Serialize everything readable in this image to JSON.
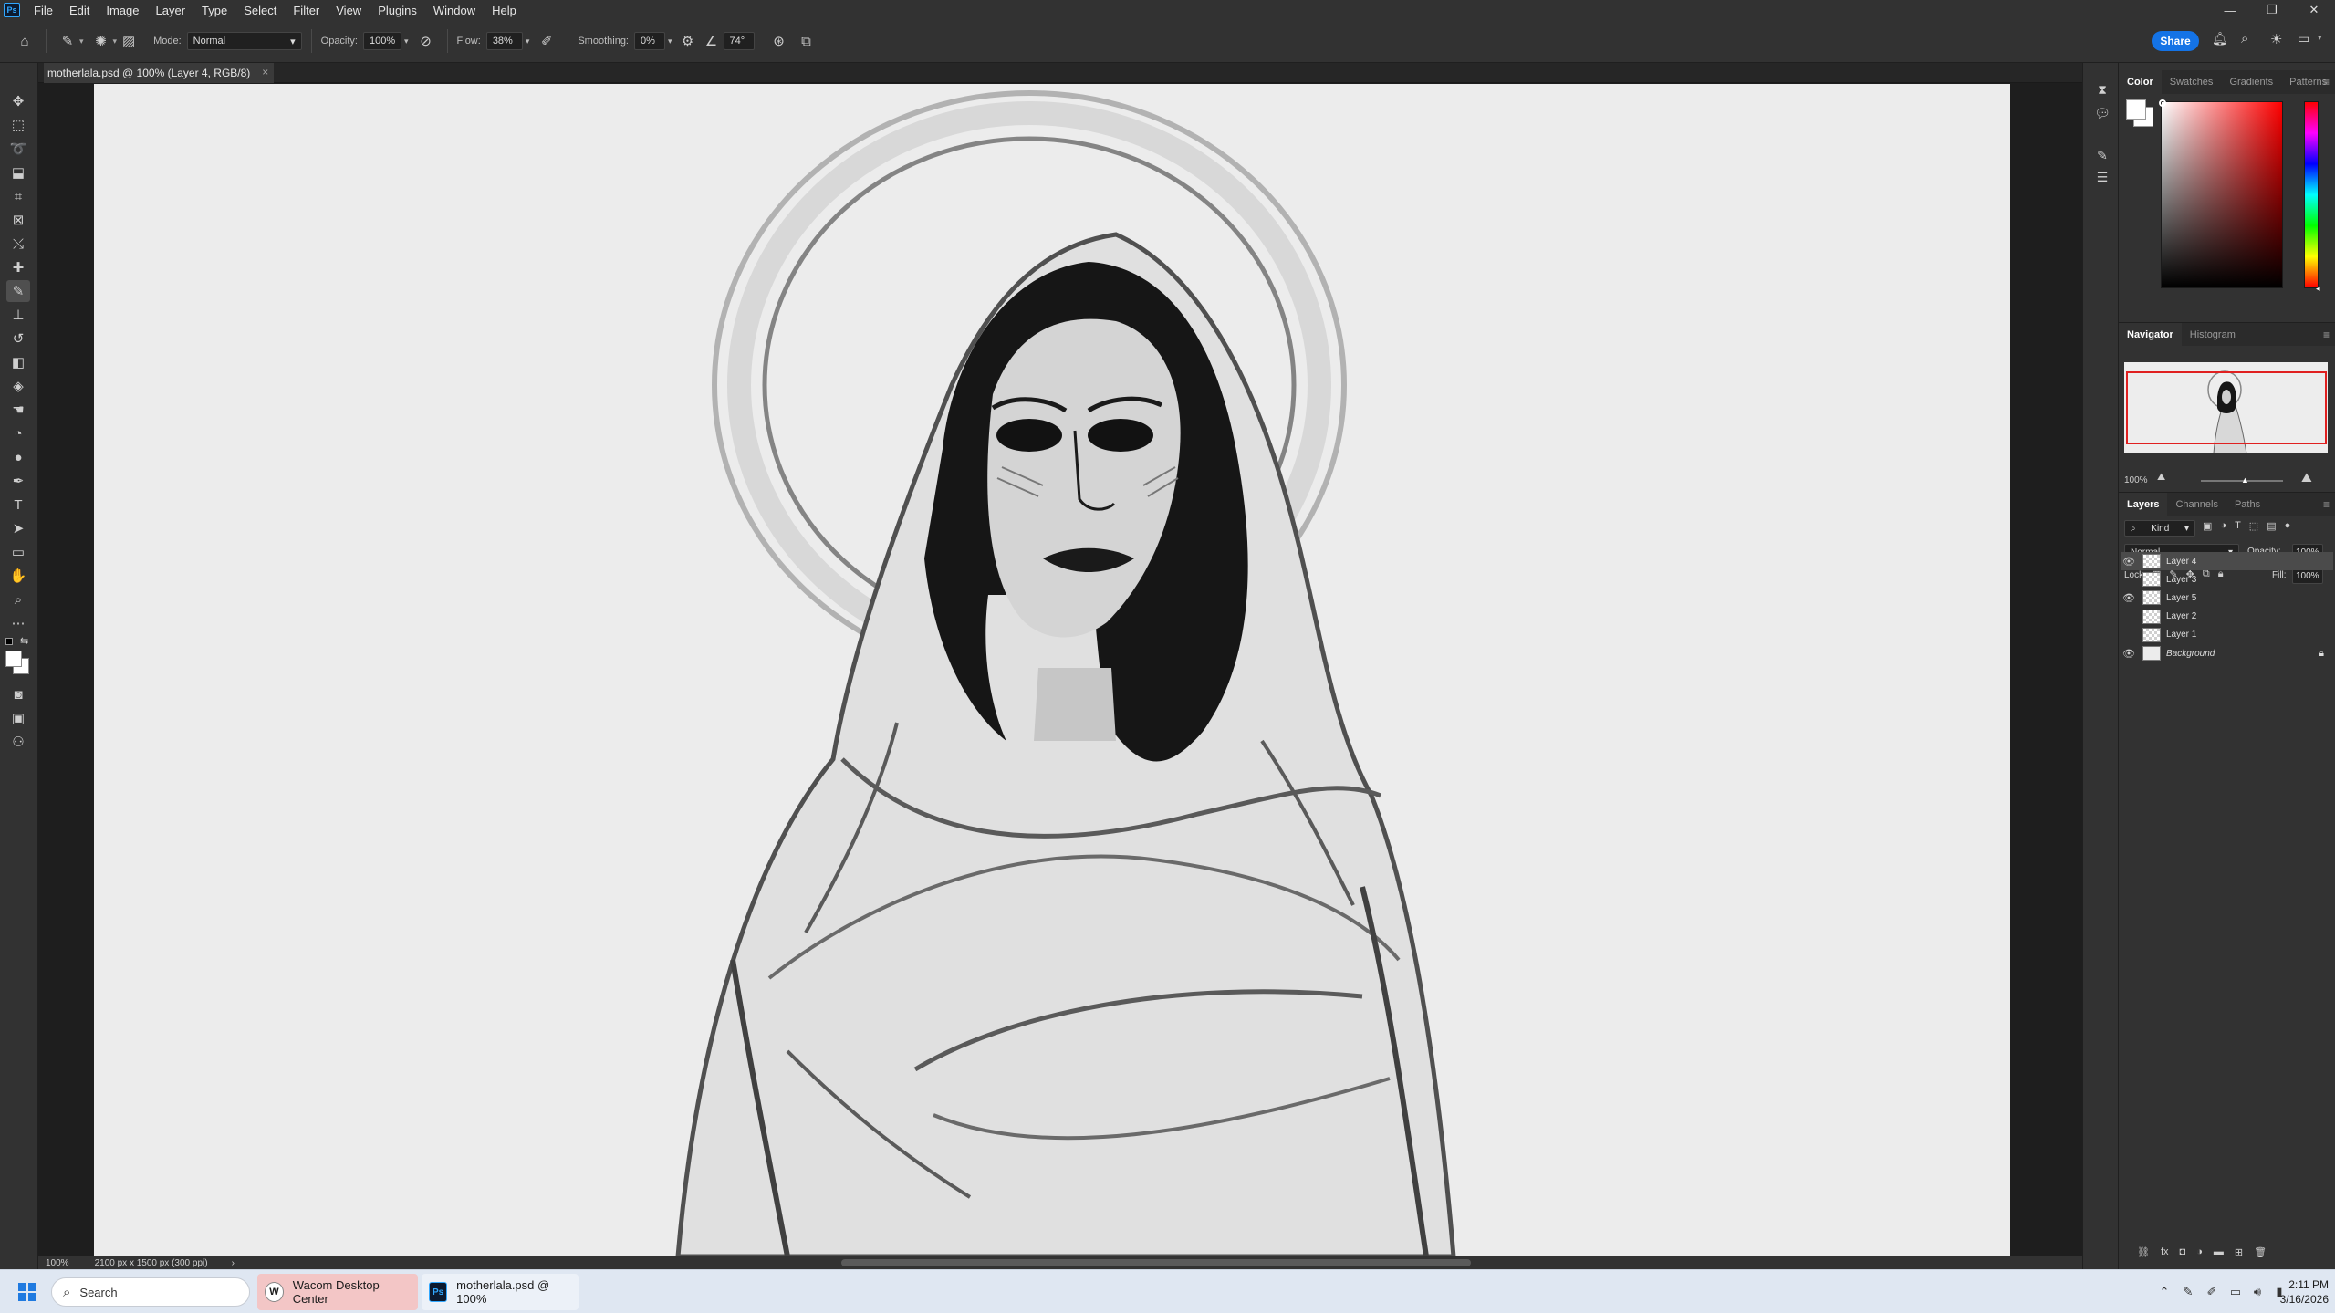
{
  "app": {
    "logo_text": "Ps"
  },
  "menu": {
    "items": [
      "File",
      "Edit",
      "Image",
      "Layer",
      "Type",
      "Select",
      "Filter",
      "View",
      "Plugins",
      "Window",
      "Help"
    ]
  },
  "window_controls": {
    "minimize": "—",
    "restore": "❐",
    "close": "✕"
  },
  "options_bar": {
    "mode_label": "Mode:",
    "mode_value": "Normal",
    "opacity_label": "Opacity:",
    "opacity_value": "100%",
    "flow_label": "Flow:",
    "flow_value": "38%",
    "smoothing_label": "Smoothing:",
    "smoothing_value": "0%",
    "angle_value": "74°",
    "share_label": "Share"
  },
  "document": {
    "tab_title": "motherlala.psd @ 100% (Layer 4, RGB/8)",
    "tab_close": "×"
  },
  "status_bar": {
    "zoom": "100%",
    "doc_info": "2100 px x 1500 px (300 ppi)",
    "arrow": "›"
  },
  "color_panel": {
    "tabs": [
      "Color",
      "Swatches",
      "Gradients",
      "Patterns"
    ],
    "active_tab": "Color",
    "foreground": "#ffffff",
    "background": "#ffffff",
    "hue_hex": "#ff0000"
  },
  "navigator_panel": {
    "tabs": [
      "Navigator",
      "Histogram"
    ],
    "zoom": "100%"
  },
  "layers_panel": {
    "tabs": [
      "Layers",
      "Channels",
      "Paths"
    ],
    "filter_label": "Kind",
    "blend_mode": "Normal",
    "opacity_label": "Opacity:",
    "opacity_value": "100%",
    "lock_label": "Lock:",
    "fill_label": "Fill:",
    "fill_value": "100%",
    "layers": [
      {
        "name": "Layer 4",
        "visible": true,
        "selected": true
      },
      {
        "name": "Layer 3",
        "visible": false,
        "selected": false
      },
      {
        "name": "Layer 5",
        "visible": true,
        "selected": false
      },
      {
        "name": "Layer 2",
        "visible": false,
        "selected": false
      },
      {
        "name": "Layer 1",
        "visible": false,
        "selected": false
      },
      {
        "name": "Background",
        "visible": true,
        "selected": false,
        "locked": true
      }
    ]
  },
  "taskbar": {
    "search_placeholder": "Search",
    "apps": [
      {
        "label": "Wacom Desktop Center",
        "icon": "W"
      },
      {
        "label": "motherlala.psd @ 100%",
        "icon": "Ps"
      }
    ],
    "time": "2:11 PM",
    "date": "3/16/2026"
  }
}
